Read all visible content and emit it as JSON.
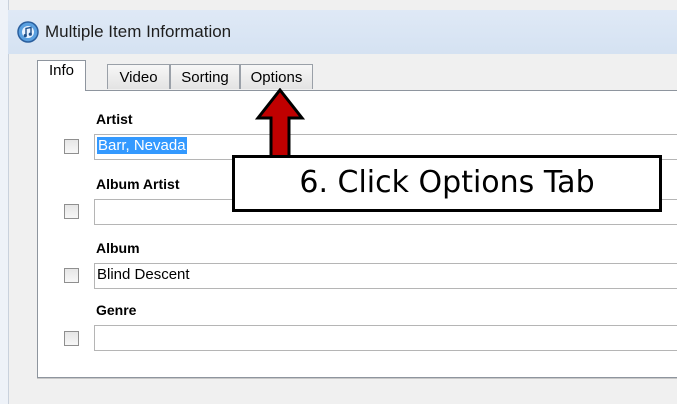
{
  "window": {
    "title": "Multiple Item Information",
    "icon": "itunes-icon"
  },
  "tabs": [
    {
      "label": "Info",
      "active": true
    },
    {
      "label": "Video",
      "active": false
    },
    {
      "label": "Sorting",
      "active": false
    },
    {
      "label": "Options",
      "active": false
    }
  ],
  "fields": {
    "artist": {
      "label": "Artist",
      "value": "Barr, Nevada",
      "checked": false
    },
    "album_artist": {
      "label": "Album Artist",
      "value": "",
      "checked": false
    },
    "album": {
      "label": "Album",
      "value": "Blind Descent",
      "checked": false
    },
    "genre": {
      "label": "Genre",
      "value": "",
      "checked": false
    }
  },
  "annotation": {
    "text": "6. Click Options Tab",
    "arrow_color": "#c00000"
  }
}
